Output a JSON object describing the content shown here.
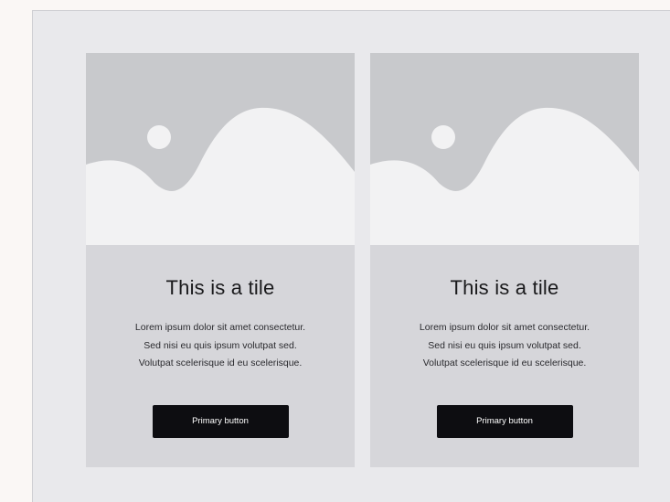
{
  "colors": {
    "page_background": "#faf7f5",
    "frame_background": "#e9e9ec",
    "tile_background": "#d6d6da",
    "image_sky": "#c8c9cc",
    "image_hill": "#f2f2f3",
    "button_background": "#0d0d11",
    "button_text": "#ffffff"
  },
  "tiles": [
    {
      "image_icon": "landscape-placeholder",
      "title": "This is a tile",
      "description_lines": [
        "Lorem ipsum dolor sit amet consectetur.",
        "Sed nisi eu quis ipsum volutpat sed.",
        "Volutpat scelerisque id eu scelerisque."
      ],
      "button_label": "Primary button"
    },
    {
      "image_icon": "landscape-placeholder",
      "title": "This is a tile",
      "description_lines": [
        "Lorem ipsum dolor sit amet consectetur.",
        "Sed nisi eu quis ipsum volutpat sed.",
        "Volutpat scelerisque id eu scelerisque."
      ],
      "button_label": "Primary button"
    }
  ]
}
